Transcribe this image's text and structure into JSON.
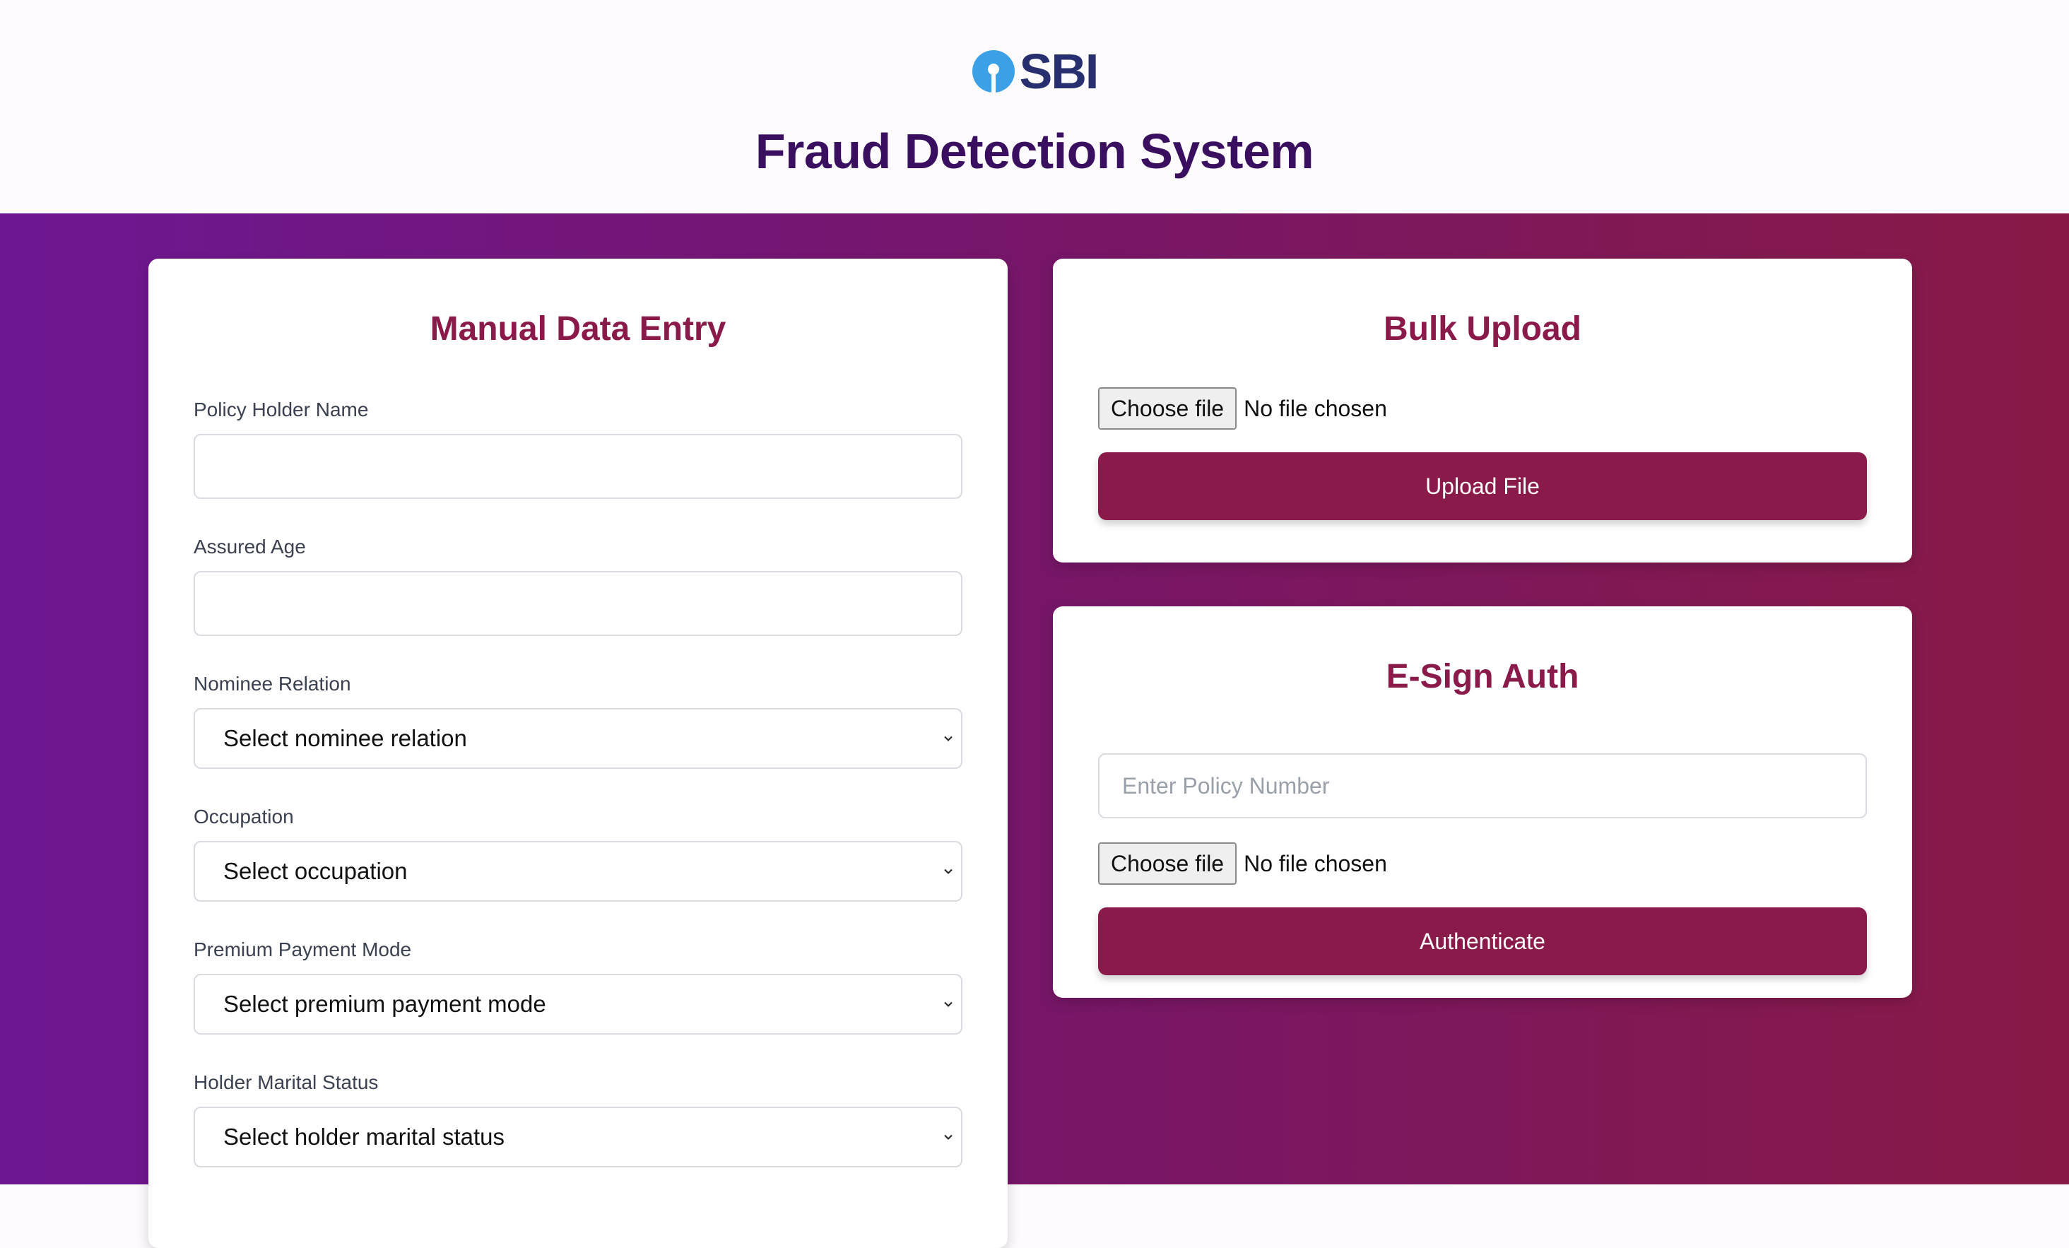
{
  "header": {
    "logo_text": "SBI",
    "title": "Fraud Detection System"
  },
  "manual_entry": {
    "title": "Manual Data Entry",
    "fields": {
      "policy_holder_name": {
        "label": "Policy Holder Name",
        "value": ""
      },
      "assured_age": {
        "label": "Assured Age",
        "value": ""
      },
      "nominee_relation": {
        "label": "Nominee Relation",
        "selected": "Select nominee relation"
      },
      "occupation": {
        "label": "Occupation",
        "selected": "Select occupation"
      },
      "premium_payment_mode": {
        "label": "Premium Payment Mode",
        "selected": "Select premium payment mode"
      },
      "holder_marital_status": {
        "label": "Holder Marital Status",
        "selected": "Select holder marital status"
      }
    }
  },
  "bulk_upload": {
    "title": "Bulk Upload",
    "choose_file_label": "Choose file",
    "file_status": "No file chosen",
    "upload_button": "Upload File"
  },
  "esign_auth": {
    "title": "E-Sign Auth",
    "policy_number_placeholder": "Enter Policy Number",
    "choose_file_label": "Choose file",
    "file_status": "No file chosen",
    "authenticate_button": "Authenticate"
  },
  "colors": {
    "brand_blue": "#272f6e",
    "logo_icon_blue": "#3ba0e6",
    "title_purple": "#3b0f5f",
    "accent_maroon": "#8a1a4a",
    "gradient_start": "#6d1793",
    "gradient_end": "#891a47"
  }
}
